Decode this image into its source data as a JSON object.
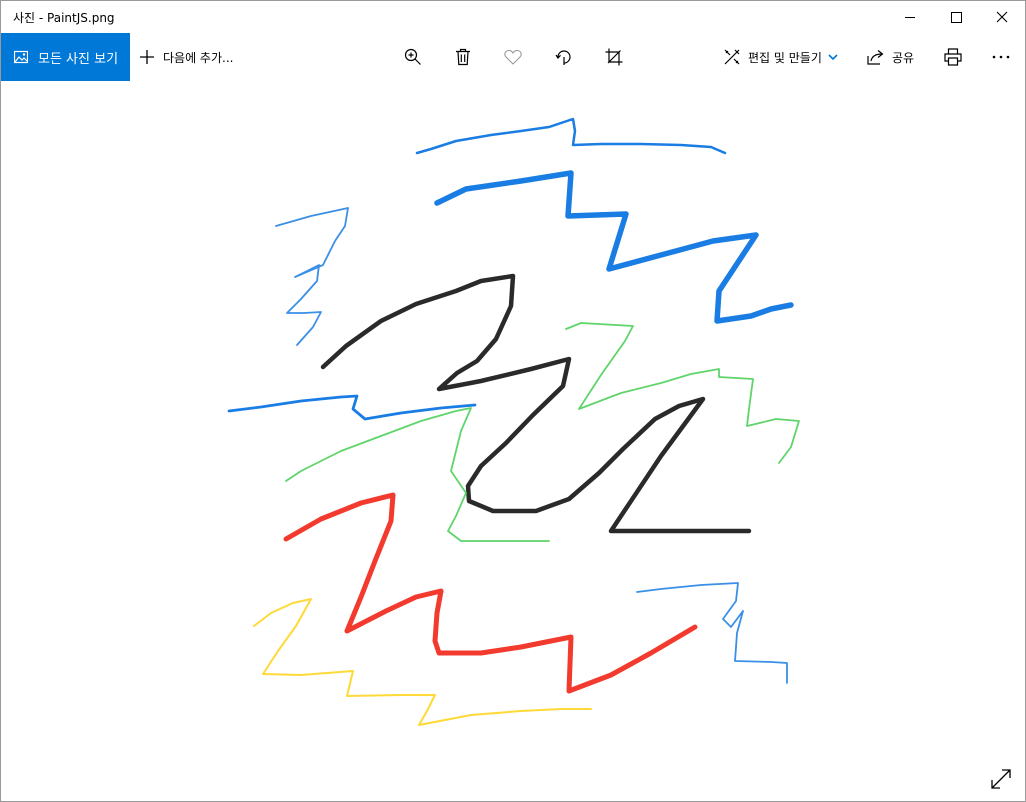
{
  "window": {
    "title": "사진 - PaintJS.png"
  },
  "toolbar": {
    "all_photos_label": "모든 사진 보기",
    "add_to_label": "다음에 추가...",
    "edit_create_label": "편집 및 만들기",
    "share_label": "공유"
  },
  "icons": {
    "all_photos": "image-icon",
    "add": "plus-icon",
    "zoom": "zoom-in-icon",
    "delete": "trash-icon",
    "favorite": "heart-icon",
    "rotate": "rotate-icon",
    "crop": "crop-icon",
    "edit": "edit-create-icon",
    "share": "share-icon",
    "print": "printer-icon",
    "more": "more-icon",
    "fullscreen": "fullscreen-icon"
  },
  "colors": {
    "accent": "#0078d7",
    "stroke_blue": "#1a7de3",
    "stroke_black": "#2a2a2a",
    "stroke_green": "#5fd46a",
    "stroke_red": "#f23b2e",
    "stroke_yellow": "#ffd938"
  }
}
